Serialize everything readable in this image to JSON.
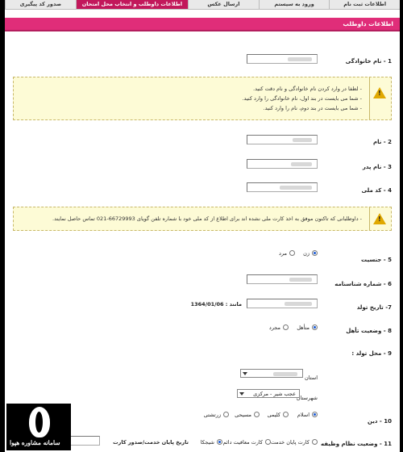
{
  "tabs": [
    {
      "label": "اطلاعات ثبت نام",
      "active": false
    },
    {
      "label": "ورود به سیستم",
      "active": false
    },
    {
      "label": "ارسال عکس",
      "active": false
    },
    {
      "label": "اطلاعات داوطلب و انتخاب محل امتحان",
      "active": true
    },
    {
      "label": "صدور کد پیگیری",
      "active": false
    }
  ],
  "section_title": "اطلاعات داوطلب",
  "fields": {
    "last_name_label": "1 - نام خانوادگی",
    "first_name_label": "2 - نام",
    "father_name_label": "3 - نام پدر",
    "national_code_label": "4 - کد ملی",
    "gender_label": "5 - جنسیت",
    "id_number_label": "6 - شماره شناسنامه",
    "birth_date_label": "7- تاریخ تولد",
    "marital_label": "8 - وضعیت تأهل",
    "birth_place_label": "9 - محل تولد :",
    "religion_label": "10 - دین",
    "military_label": "11 - وضعیت نظام وظیفه"
  },
  "warning1": {
    "lines": [
      "- لطفا در وارد کردن نام خانوادگی و نام دقت کنید.",
      "- شما می بایست در بند اول، نام خانوادگی را وارد کنید.",
      "- شما می بایست در بند دوم، نام را وارد کنید."
    ]
  },
  "warning2": {
    "text": "- داوطلبانی که تاکنون موفق به اخذ کارت ملی نشده اند برای اطلاع از کد ملی خود با شماره تلفن گویای 66729993-021 تماس حاصل نمایند."
  },
  "gender": {
    "options": [
      "زن",
      "مرد"
    ],
    "selected": "زن"
  },
  "birth_hint": "مانند : 1364/01/06",
  "marital": {
    "options": [
      "متأهل",
      "مجرد"
    ],
    "selected": "متأهل"
  },
  "province_label": "استان",
  "city_label": "شهرستان",
  "city_value": "عجب شیر - مرکزی",
  "religion": {
    "options": [
      "اسلام",
      "کلیمی",
      "مسیحی",
      "زرتشتی"
    ],
    "selected": "اسلام"
  },
  "military": {
    "options": [
      "کارت پایان خدمت",
      "کارت معافیت دائم",
      "شیجکا"
    ],
    "selected": "شیجکا",
    "date_label": "تاریخ پایان خدمت/صدور کارت"
  },
  "logo": {
    "text": "سامانه مشاوره هپوا"
  },
  "colors": {
    "accent": "#e02d79",
    "tab_active": "#c2185b",
    "warning_bg": "#fdfbd6",
    "warning_icon": "#e0a800"
  },
  "icons": [
    "warning-icon",
    "chevron-down-icon"
  ]
}
